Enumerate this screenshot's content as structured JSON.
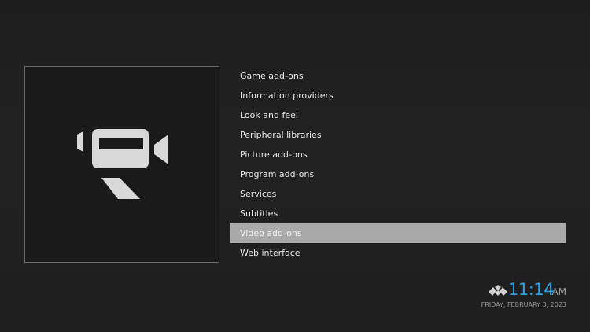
{
  "preview": {
    "icon": "video-camera-icon"
  },
  "categories": [
    {
      "label": "Game add-ons"
    },
    {
      "label": "Information providers"
    },
    {
      "label": "Look and feel"
    },
    {
      "label": "Peripheral libraries"
    },
    {
      "label": "Picture add-ons"
    },
    {
      "label": "Program add-ons"
    },
    {
      "label": "Services"
    },
    {
      "label": "Subtitles"
    },
    {
      "label": "Video add-ons",
      "selected": true
    },
    {
      "label": "Web interface"
    }
  ],
  "clock": {
    "time": "11:14",
    "ampm": "AM",
    "date": "FRIDAY, FEBRUARY 3, 2023",
    "logo_icon": "kodi-logo-icon"
  },
  "colors": {
    "accent": "#2aa1e6",
    "selection": "#a9a9a9",
    "icon_fill": "#d9d9d9"
  }
}
